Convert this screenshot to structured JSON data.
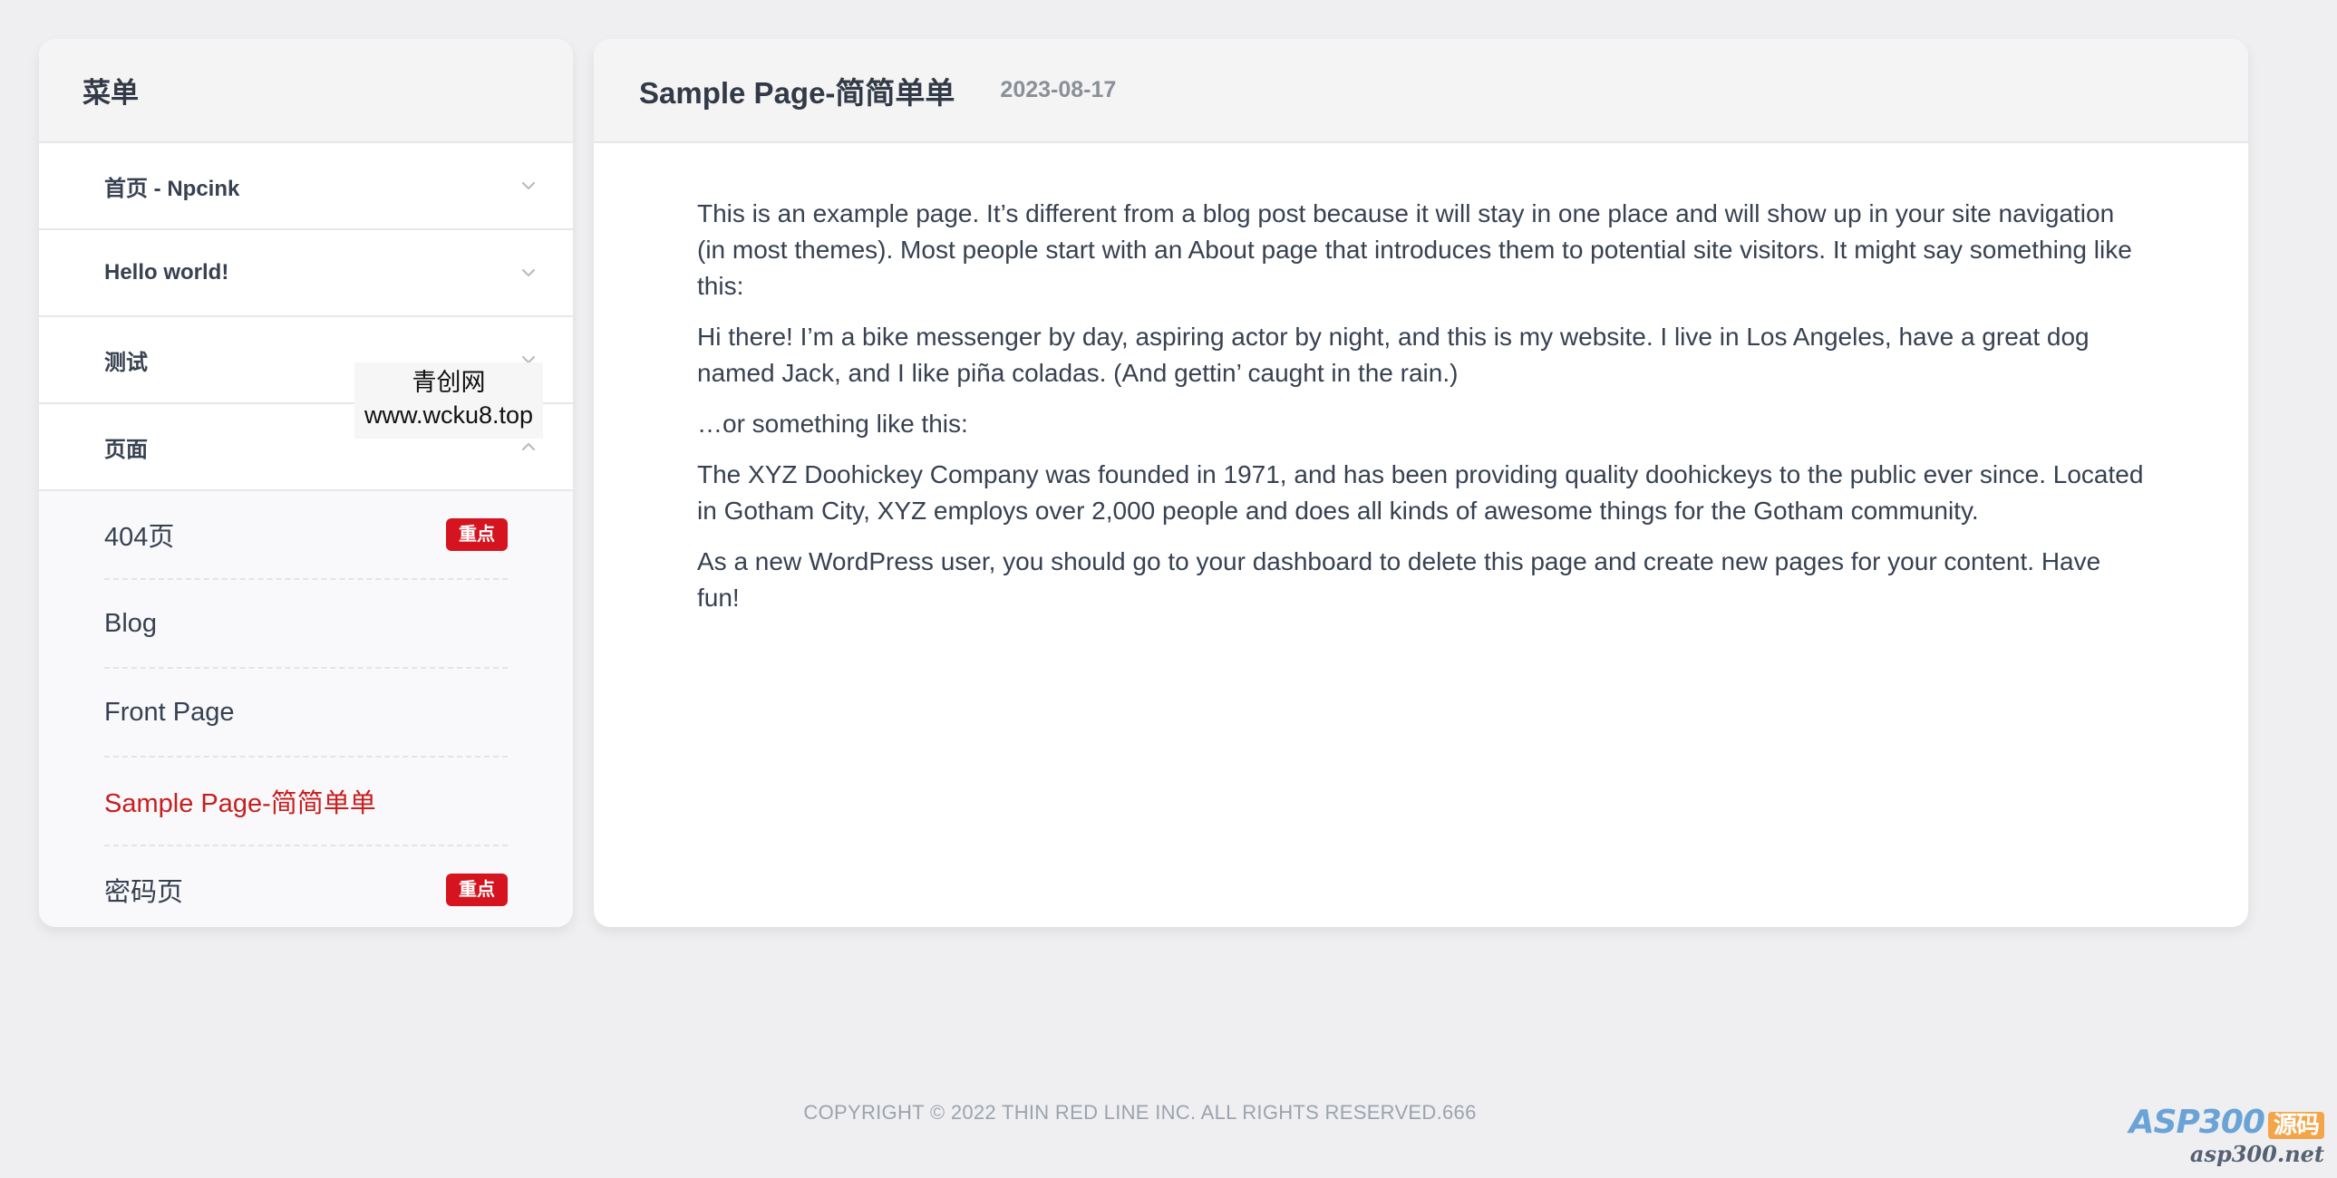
{
  "sidebar": {
    "title": "菜单",
    "groups": [
      {
        "label": "首页 - Npcink"
      },
      {
        "label": "Hello world!"
      },
      {
        "label": "测试"
      },
      {
        "label": "页面"
      }
    ],
    "pages": [
      {
        "label": "404页",
        "badge": "重点"
      },
      {
        "label": "Blog"
      },
      {
        "label": "Front Page"
      },
      {
        "label": "Sample Page-简简单单"
      },
      {
        "label": "密码页",
        "badge": "重点"
      }
    ]
  },
  "overlay": {
    "line1": "青创网",
    "line2": "www.wcku8.top"
  },
  "content": {
    "title": "Sample Page-简简单单",
    "date": "2023-08-17",
    "paragraphs": [
      "This is an example page. It’s different from a blog post because it will stay in one place and will show up in your site navigation (in most themes). Most people start with an About page that introduces them to potential site visitors. It might say something like this:",
      "Hi there! I’m a bike messenger by day, aspiring actor by night, and this is my website. I live in Los Angeles, have a great dog named Jack, and I like piña coladas. (And gettin’ caught in the rain.)",
      "…or something like this:",
      "The XYZ Doohickey Company was founded in 1971, and has been providing quality doohickeys to the public ever since. Located in Gotham City, XYZ employs over 2,000 people and does all kinds of awesome things for the Gotham community.",
      "As a new WordPress user, you should go to your dashboard to delete this page and create new pages for your content. Have fun!"
    ]
  },
  "footer": {
    "copyright": "COPYRIGHT © 2022 THIN RED LINE INC. ALL RIGHTS RESERVED.666"
  },
  "corner_logo": {
    "brand": "ASP300",
    "tag": "源码",
    "domain": "asp300.net"
  },
  "colors": {
    "accent": "#c81e1e",
    "badge": "#d5141f"
  }
}
